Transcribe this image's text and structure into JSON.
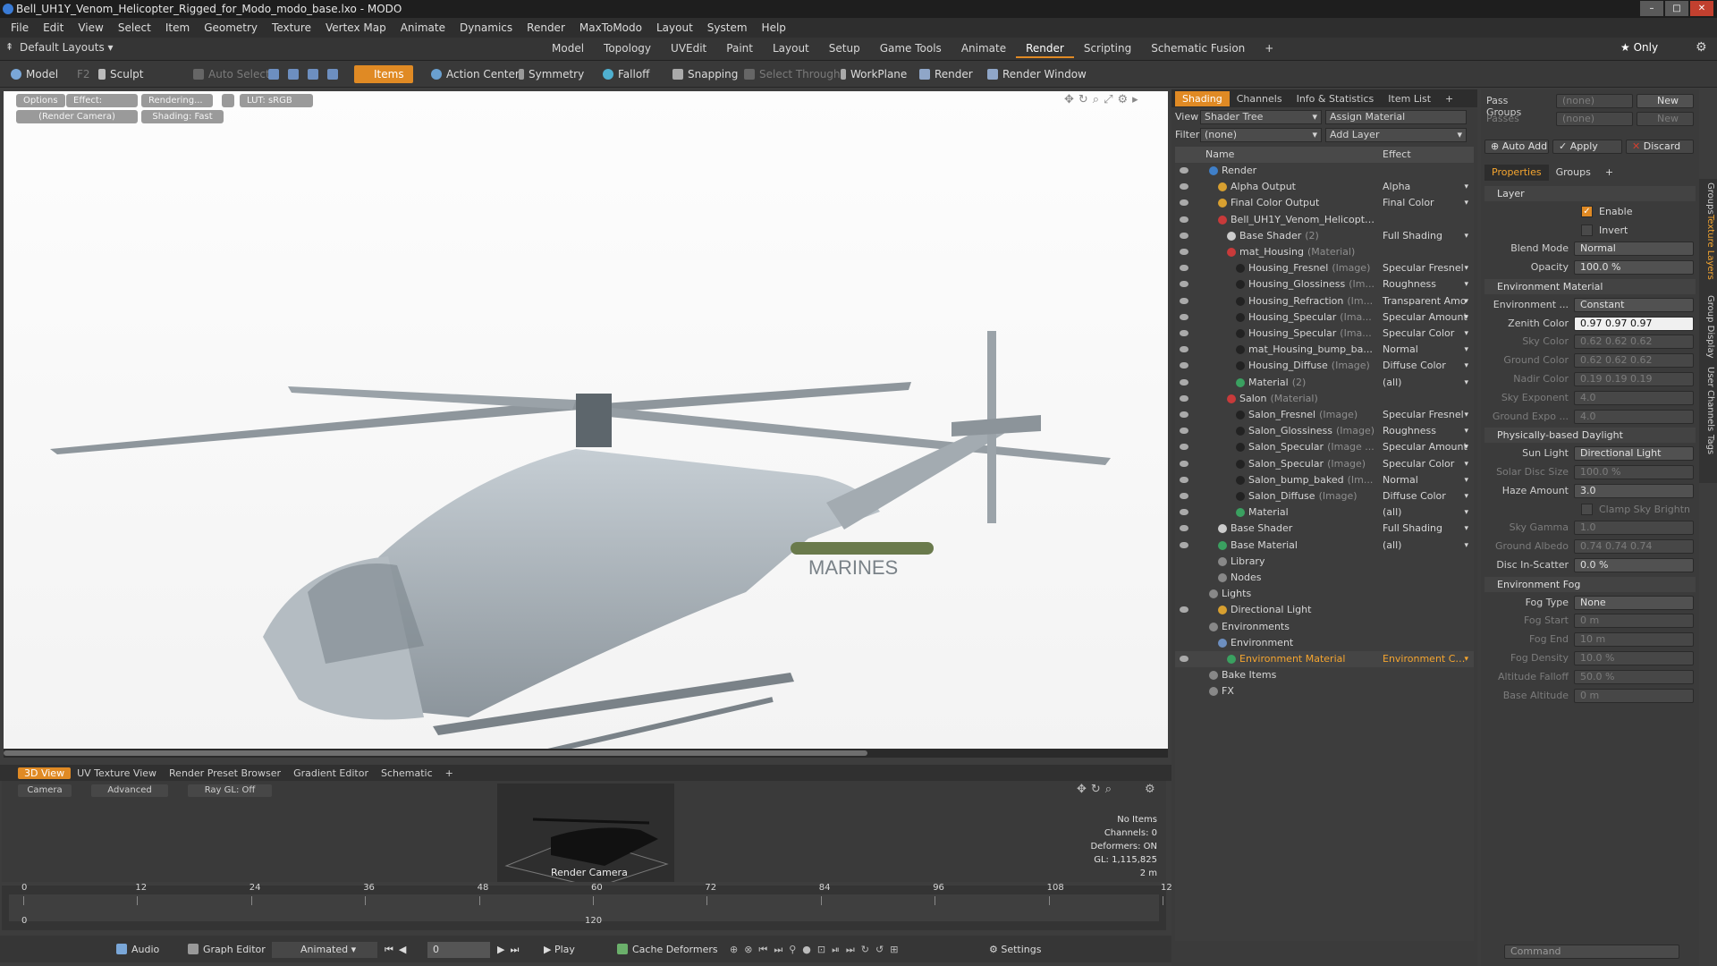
{
  "window": {
    "title": "Bell_UH1Y_Venom_Helicopter_Rigged_for_Modo_modo_base.lxo - MODO"
  },
  "menu": [
    "File",
    "Edit",
    "View",
    "Select",
    "Item",
    "Geometry",
    "Texture",
    "Vertex Map",
    "Animate",
    "Dynamics",
    "Render",
    "MaxToModo",
    "Layout",
    "System",
    "Help"
  ],
  "layouts": {
    "current": "Default Layouts",
    "tabs": [
      "Model",
      "Topology",
      "UVEdit",
      "Paint",
      "Layout",
      "Setup",
      "Game Tools",
      "Animate",
      "Render",
      "Scripting",
      "Schematic Fusion",
      "+"
    ],
    "active": "Render",
    "only": "Only"
  },
  "toolbar": {
    "model": "Model",
    "model_key": "F2",
    "sculpt": "Sculpt",
    "auto_select": "Auto Select",
    "items": "Items",
    "action_center": "Action Center",
    "symmetry": "Symmetry",
    "falloff": "Falloff",
    "snapping": "Snapping",
    "select_through": "Select Through",
    "workplane": "WorkPlane",
    "render": "Render",
    "render_window": "Render Window"
  },
  "viewport": {
    "options": "Options",
    "effect": "Effect: (Shadi...",
    "rendering": "Rendering...",
    "lut": "LUT: sRGB",
    "camera": "(Render Camera)",
    "shading": "Shading: Fast"
  },
  "bottom_tabs": [
    "3D View",
    "UV Texture View",
    "Render Preset Browser",
    "Gradient Editor",
    "Schematic",
    "+"
  ],
  "mini": {
    "camera": "Camera",
    "advanced": "Advanced",
    "raygl": "Ray GL: Off",
    "label": "Render Camera",
    "stats": [
      "No Items",
      "Channels: 0",
      "Deformers: ON",
      "GL: 1,115,825",
      "2 m"
    ]
  },
  "timeline": {
    "ticks": [
      "0",
      "12",
      "24",
      "36",
      "48",
      "60",
      "72",
      "84",
      "96",
      "108",
      "120"
    ],
    "sub": [
      "0",
      "",
      "",
      "",
      "",
      "120"
    ]
  },
  "transport": {
    "audio": "Audio",
    "graph_editor": "Graph Editor",
    "animated": "Animated",
    "frame": "0",
    "play": "Play",
    "cache": "Cache Deformers",
    "settings": "Settings"
  },
  "shading": {
    "tabs": [
      "Shading",
      "Channels",
      "Info & Statistics",
      "Item List",
      "+"
    ],
    "view_label": "View",
    "view_value": "Shader Tree",
    "assign": "Assign Material",
    "filter_label": "Filter",
    "filter_value": "(none)",
    "add_layer": "Add Layer",
    "col_name": "Name",
    "col_effect": "Effect",
    "rows": [
      {
        "name": "Render",
        "suffix": "",
        "effect": "",
        "indent": 0
      },
      {
        "name": "Alpha Output",
        "suffix": "",
        "effect": "Alpha",
        "indent": 1
      },
      {
        "name": "Final Color Output",
        "suffix": "",
        "effect": "Final Color",
        "indent": 1
      },
      {
        "name": "Bell_UH1Y_Venom_Helicopte ...",
        "suffix": "",
        "effect": "",
        "indent": 1
      },
      {
        "name": "Base Shader",
        "suffix": "(2)",
        "effect": "Full Shading",
        "indent": 2
      },
      {
        "name": "mat_Housing",
        "suffix": "(Material)",
        "effect": "",
        "indent": 2
      },
      {
        "name": "Housing_Fresnel",
        "suffix": "(Image)",
        "effect": "Specular Fresnel",
        "indent": 3
      },
      {
        "name": "Housing_Glossiness",
        "suffix": "(Im...",
        "effect": "Roughness",
        "indent": 3
      },
      {
        "name": "Housing_Refraction",
        "suffix": "(Im...",
        "effect": "Transparent Amo",
        "indent": 3
      },
      {
        "name": "Housing_Specular",
        "suffix": "(Ima...",
        "effect": "Specular Amount",
        "indent": 3
      },
      {
        "name": "Housing_Specular",
        "suffix": "(Ima...",
        "effect": "Specular Color",
        "indent": 3
      },
      {
        "name": "mat_Housing_bump_ba...",
        "suffix": "",
        "effect": "Normal",
        "indent": 3
      },
      {
        "name": "Housing_Diffuse",
        "suffix": "(Image)",
        "effect": "Diffuse Color",
        "indent": 3
      },
      {
        "name": "Material",
        "suffix": "(2)",
        "effect": "(all)",
        "indent": 3
      },
      {
        "name": "Salon",
        "suffix": "(Material)",
        "effect": "",
        "indent": 2
      },
      {
        "name": "Salon_Fresnel",
        "suffix": "(Image)",
        "effect": "Specular Fresnel",
        "indent": 3
      },
      {
        "name": "Salon_Glossiness",
        "suffix": "(Image)",
        "effect": "Roughness",
        "indent": 3
      },
      {
        "name": "Salon_Specular",
        "suffix": "(Image ...",
        "effect": "Specular Amount",
        "indent": 3
      },
      {
        "name": "Salon_Specular",
        "suffix": "(Image)",
        "effect": "Specular Color",
        "indent": 3
      },
      {
        "name": "Salon_bump_baked",
        "suffix": "(Im...",
        "effect": "Normal",
        "indent": 3
      },
      {
        "name": "Salon_Diffuse",
        "suffix": "(Image)",
        "effect": "Diffuse Color",
        "indent": 3
      },
      {
        "name": "Material",
        "suffix": "",
        "effect": "(all)",
        "indent": 3
      },
      {
        "name": "Base Shader",
        "suffix": "",
        "effect": "Full Shading",
        "indent": 1
      },
      {
        "name": "Base Material",
        "suffix": "",
        "effect": "(all)",
        "indent": 1
      },
      {
        "name": "Library",
        "suffix": "",
        "effect": "",
        "indent": 1
      },
      {
        "name": "Nodes",
        "suffix": "",
        "effect": "",
        "indent": 1
      },
      {
        "name": "Lights",
        "suffix": "",
        "effect": "",
        "indent": 0
      },
      {
        "name": "Directional Light",
        "suffix": "",
        "effect": "",
        "indent": 1
      },
      {
        "name": "Environments",
        "suffix": "",
        "effect": "",
        "indent": 0
      },
      {
        "name": "Environment",
        "suffix": "",
        "effect": "",
        "indent": 1
      },
      {
        "name": "Environment Material",
        "suffix": "",
        "effect": "Environment Color",
        "indent": 2
      },
      {
        "name": "Bake Items",
        "suffix": "",
        "effect": "",
        "indent": 0
      },
      {
        "name": "FX",
        "suffix": "",
        "effect": "",
        "indent": 0
      }
    ]
  },
  "props": {
    "pass_groups": "Pass Groups",
    "pass_groups_val": "(none)",
    "new": "New",
    "passes": "Passes",
    "passes_val": "(none)",
    "new2": "New",
    "auto_add": "Auto Add",
    "apply": "Apply",
    "discard": "Discard",
    "tabs": [
      "Properties",
      "Groups",
      "+"
    ],
    "layer": "Layer",
    "enable": "Enable",
    "invert": "Invert",
    "blend_mode": "Blend Mode",
    "blend_val": "Normal",
    "opacity": "Opacity",
    "opacity_val": "100.0 %",
    "env_material": "Environment Material",
    "environment": "Environment ...",
    "environment_val": "Constant",
    "zenith": "Zenith Color",
    "zenith_val": "0.97   0.97   0.97",
    "sky": "Sky Color",
    "sky_val": "0.62   0.62   0.62",
    "ground": "Ground Color",
    "ground_val": "0.62   0.62   0.62",
    "nadir": "Nadir Color",
    "nadir_val": "0.19   0.19   0.19",
    "sky_exp": "Sky Exponent",
    "sky_exp_val": "4.0",
    "ground_exp": "Ground Expo ...",
    "ground_exp_val": "4.0",
    "pbd": "Physically-based Daylight",
    "sun_light": "Sun Light",
    "sun_light_val": "Directional Light",
    "solar": "Solar Disc Size",
    "solar_val": "100.0 %",
    "haze": "Haze Amount",
    "haze_val": "3.0",
    "clamp": "Clamp Sky Brightn ...",
    "sky_gamma": "Sky Gamma",
    "sky_gamma_val": "1.0",
    "albedo": "Ground Albedo",
    "albedo_val": "0.74   0.74   0.74",
    "disc": "Disc In-Scatter",
    "disc_val": "0.0 %",
    "fog": "Environment Fog",
    "fog_type": "Fog Type",
    "fog_type_val": "None",
    "fog_start": "Fog Start",
    "fog_start_val": "0 m",
    "fog_end": "Fog End",
    "fog_end_val": "10 m",
    "fog_density": "Fog Density",
    "fog_density_val": "10.0 %",
    "alt_falloff": "Altitude Falloff",
    "alt_falloff_val": "50.0 %",
    "base_alt": "Base Altitude",
    "base_alt_val": "0 m",
    "command": "Command"
  },
  "side_tabs": [
    "Groups",
    "Texture Layers",
    "Group Display",
    "User Channels",
    "Tags"
  ],
  "colors": {
    "accent": "#e08a24",
    "panel": "#3b3b3b"
  }
}
